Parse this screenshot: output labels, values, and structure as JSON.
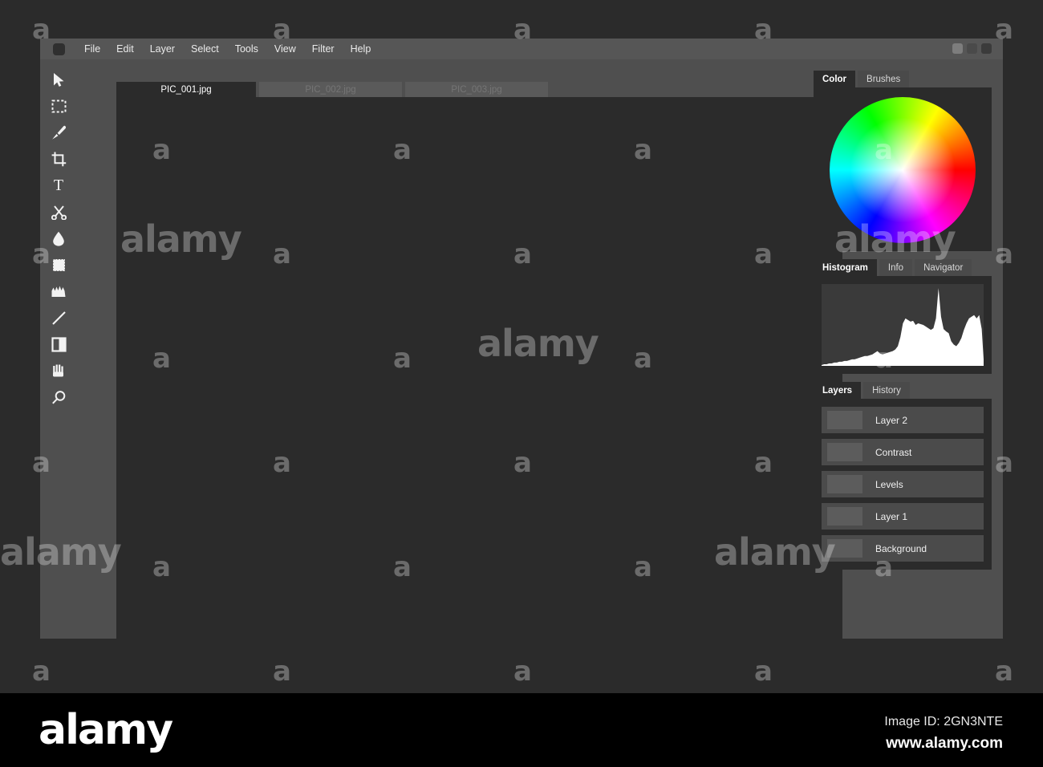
{
  "window": {
    "menu_items": [
      "File",
      "Edit",
      "Layer",
      "Select",
      "Tools",
      "View",
      "Filter",
      "Help"
    ],
    "app_icon": "app-dot-icon",
    "controls": [
      "minimize-button",
      "maximize-button",
      "close-button"
    ]
  },
  "toolbox": {
    "tools": [
      {
        "name": "move-tool",
        "icon": "cursor-arrow-icon"
      },
      {
        "name": "marquee-select-tool",
        "icon": "dashed-rectangle-icon"
      },
      {
        "name": "brush-tool",
        "icon": "paintbrush-icon"
      },
      {
        "name": "crop-tool",
        "icon": "crop-icon"
      },
      {
        "name": "text-tool",
        "icon": "text-t-icon",
        "glyph": "T"
      },
      {
        "name": "scissors-tool",
        "icon": "scissors-icon"
      },
      {
        "name": "blur-droplet-tool",
        "icon": "water-droplet-icon"
      },
      {
        "name": "pattern-stamp-tool",
        "icon": "dotted-square-icon"
      },
      {
        "name": "smudge-tool",
        "icon": "smudge-icon"
      },
      {
        "name": "line-tool",
        "icon": "diagonal-line-icon"
      },
      {
        "name": "gradient-tool",
        "icon": "half-filled-square-icon"
      },
      {
        "name": "hand-tool",
        "icon": "hand-icon"
      },
      {
        "name": "zoom-tool",
        "icon": "magnifier-icon"
      }
    ]
  },
  "documents": {
    "tabs": [
      {
        "label": "PIC_001.jpg",
        "active": true
      },
      {
        "label": "PIC_002.jpg",
        "active": false
      },
      {
        "label": "PIC_003.jpg",
        "active": false
      }
    ]
  },
  "panels": {
    "color": {
      "tabs": [
        {
          "label": "Color",
          "active": true
        },
        {
          "label": "Brushes",
          "active": false
        }
      ],
      "widget": "color-wheel"
    },
    "histogram": {
      "tabs": [
        {
          "label": "Histogram",
          "active": true
        },
        {
          "label": "Info",
          "active": false
        },
        {
          "label": "Navigator",
          "active": false
        }
      ]
    },
    "layers": {
      "tabs": [
        {
          "label": "Layers",
          "active": true
        },
        {
          "label": "History",
          "active": false
        }
      ],
      "rows": [
        {
          "name": "Layer 2"
        },
        {
          "name": "Contrast"
        },
        {
          "name": "Levels"
        },
        {
          "name": "Layer 1"
        },
        {
          "name": "Background"
        }
      ]
    }
  },
  "watermark": {
    "letter": "a",
    "word": "alamy",
    "footer_logo": "alamy",
    "image_id": "Image ID: 2GN3NTE",
    "url": "www.alamy.com"
  },
  "chart_data": {
    "type": "area",
    "title": "Histogram",
    "xlabel": "",
    "ylabel": "",
    "x": [
      0,
      4,
      8,
      12,
      16,
      20,
      24,
      28,
      32,
      36,
      40,
      44,
      48,
      52,
      56,
      60,
      64,
      68,
      72,
      76,
      80,
      84,
      88,
      92,
      96,
      100,
      104,
      108,
      112,
      116,
      120,
      124,
      128,
      132,
      136,
      140,
      144,
      148,
      152,
      156,
      160,
      164,
      168,
      172,
      176,
      180,
      184,
      188,
      192,
      196,
      200,
      204,
      208,
      212,
      216,
      220,
      224,
      228,
      232,
      236,
      240,
      244,
      248,
      252,
      255
    ],
    "values": [
      1,
      2,
      2,
      3,
      3,
      4,
      4,
      5,
      5,
      6,
      6,
      7,
      8,
      8,
      9,
      10,
      11,
      12,
      12,
      13,
      14,
      16,
      18,
      15,
      14,
      15,
      16,
      17,
      18,
      20,
      24,
      35,
      52,
      58,
      56,
      54,
      55,
      50,
      52,
      51,
      50,
      48,
      46,
      44,
      46,
      58,
      95,
      60,
      45,
      42,
      40,
      30,
      26,
      24,
      28,
      34,
      44,
      52,
      58,
      60,
      62,
      58,
      62,
      45,
      8
    ],
    "ylim": [
      0,
      100
    ],
    "grid": false,
    "legend": null
  }
}
